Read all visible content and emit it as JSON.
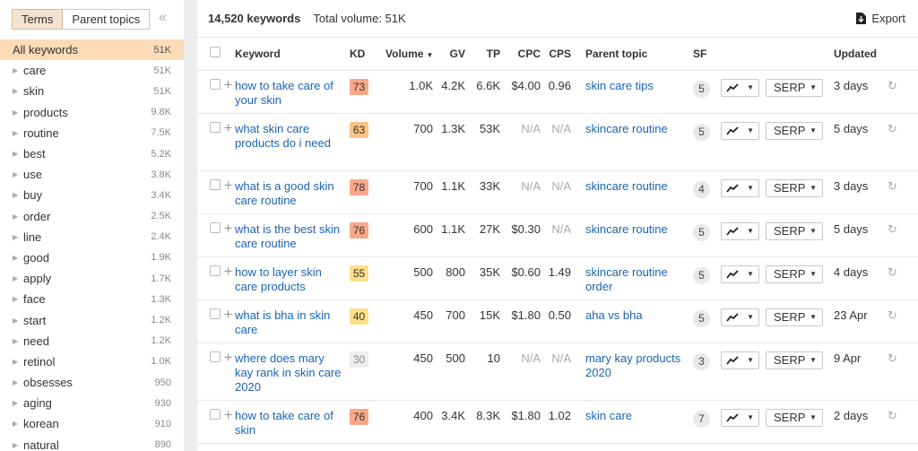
{
  "sidebar": {
    "tabs": [
      {
        "label": "Terms",
        "active": true
      },
      {
        "label": "Parent topics",
        "active": false
      }
    ],
    "collapse_icon": "double-chevron-left-icon",
    "items": [
      {
        "label": "All keywords",
        "count": "51K",
        "selected": true,
        "expandable": false
      },
      {
        "label": "care",
        "count": "51K"
      },
      {
        "label": "skin",
        "count": "51K"
      },
      {
        "label": "products",
        "count": "9.8K"
      },
      {
        "label": "routine",
        "count": "7.5K"
      },
      {
        "label": "best",
        "count": "5.2K"
      },
      {
        "label": "use",
        "count": "3.8K"
      },
      {
        "label": "buy",
        "count": "3.4K"
      },
      {
        "label": "order",
        "count": "2.5K"
      },
      {
        "label": "line",
        "count": "2.4K"
      },
      {
        "label": "good",
        "count": "1.9K"
      },
      {
        "label": "apply",
        "count": "1.7K"
      },
      {
        "label": "face",
        "count": "1.3K"
      },
      {
        "label": "start",
        "count": "1.2K"
      },
      {
        "label": "need",
        "count": "1.2K"
      },
      {
        "label": "retinol",
        "count": "1.0K"
      },
      {
        "label": "obsesses",
        "count": "950"
      },
      {
        "label": "aging",
        "count": "930"
      },
      {
        "label": "korean",
        "count": "910"
      },
      {
        "label": "natural",
        "count": "890"
      }
    ]
  },
  "header": {
    "keywords_count": "14,520 keywords",
    "total_volume": "Total volume: 51K",
    "export_label": "Export"
  },
  "table": {
    "columns": {
      "keyword": "Keyword",
      "kd": "KD",
      "volume": "Volume",
      "gv": "GV",
      "tp": "TP",
      "cpc": "CPC",
      "cps": "CPS",
      "parent_topic": "Parent topic",
      "sf": "SF",
      "updated": "Updated"
    },
    "serp_label": "SERP",
    "kd_colors": {
      "easy": "#fde08a",
      "medium": "#fcc384",
      "hard": "#f8a88a",
      "na": "#eeeeee"
    },
    "rows": [
      {
        "keyword": "how to take care of your skin",
        "kd": "73",
        "kd_level": "hard",
        "volume": "1.0K",
        "gv": "4.2K",
        "tp": "6.6K",
        "cpc": "$4.00",
        "cps": "0.96",
        "parent_topic": "skin care tips",
        "sf": "5",
        "updated": "3 days"
      },
      {
        "keyword": "what skin care products do i need",
        "kd": "63",
        "kd_level": "medium",
        "volume": "700",
        "gv": "1.3K",
        "tp": "53K",
        "cpc": "N/A",
        "cps": "N/A",
        "parent_topic": "skincare routine",
        "sf": "5",
        "updated": "5 days"
      },
      {
        "keyword": "what is a good skin care routine",
        "kd": "78",
        "kd_level": "hard",
        "volume": "700",
        "gv": "1.1K",
        "tp": "33K",
        "cpc": "N/A",
        "cps": "N/A",
        "parent_topic": "skincare routine",
        "sf": "4",
        "updated": "3 days"
      },
      {
        "keyword": "what is the best skin care routine",
        "kd": "76",
        "kd_level": "hard",
        "volume": "600",
        "gv": "1.1K",
        "tp": "27K",
        "cpc": "$0.30",
        "cps": "N/A",
        "parent_topic": "skincare routine",
        "sf": "5",
        "updated": "5 days"
      },
      {
        "keyword": "how to layer skin care products",
        "kd": "55",
        "kd_level": "easy",
        "volume": "500",
        "gv": "800",
        "tp": "35K",
        "cpc": "$0.60",
        "cps": "1.49",
        "parent_topic": "skincare routine order",
        "sf": "5",
        "updated": "4 days"
      },
      {
        "keyword": "what is bha in skin care",
        "kd": "40",
        "kd_level": "easy",
        "volume": "450",
        "gv": "700",
        "tp": "15K",
        "cpc": "$1.80",
        "cps": "0.50",
        "parent_topic": "aha vs bha",
        "sf": "5",
        "updated": "23 Apr"
      },
      {
        "keyword": "where does mary kay rank in skin care 2020",
        "kd": "30",
        "kd_level": "na",
        "volume": "450",
        "gv": "500",
        "tp": "10",
        "cpc": "N/A",
        "cps": "N/A",
        "parent_topic": "mary kay products 2020",
        "sf": "3",
        "updated": "9 Apr"
      },
      {
        "keyword": "how to take care of skin",
        "kd": "76",
        "kd_level": "hard",
        "volume": "400",
        "gv": "3.4K",
        "tp": "8.3K",
        "cpc": "$1.80",
        "cps": "1.02",
        "parent_topic": "skin care",
        "sf": "7",
        "updated": "2 days"
      },
      {
        "keyword": "",
        "kd": "",
        "kd_level": "easy",
        "volume": "",
        "gv": "",
        "tp": "",
        "cpc": "",
        "cps": "",
        "parent_topic": "",
        "sf": "",
        "updated": ""
      }
    ]
  }
}
